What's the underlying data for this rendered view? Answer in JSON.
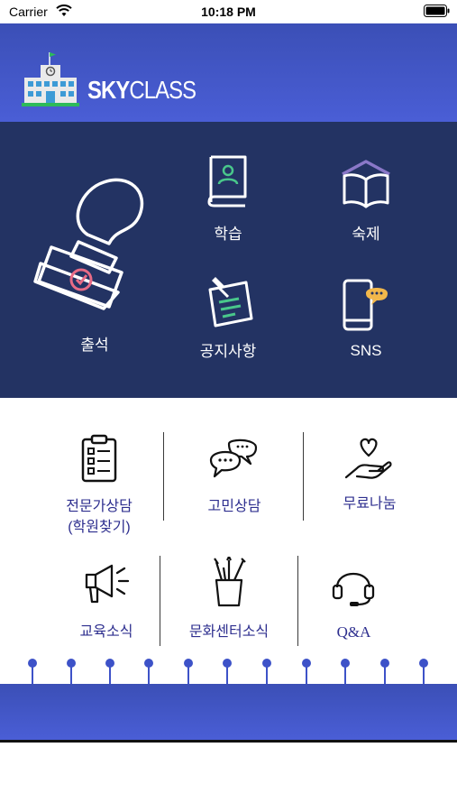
{
  "status_bar": {
    "carrier": "Carrier",
    "time": "10:18 PM"
  },
  "header": {
    "logo_bold": "SKY",
    "logo_light": "CLASS"
  },
  "dark_menu": {
    "attendance": "출석",
    "study": "학습",
    "homework": "숙제",
    "notice": "공지사항",
    "sns": "SNS"
  },
  "light_menu": {
    "consult_line1": "전문가상담",
    "consult_line2": "(학원찾기)",
    "worry": "고민상담",
    "share": "무료나눔",
    "education": "교육소식",
    "culture": "문화센터소식",
    "qa": "Q&A"
  },
  "colors": {
    "header": "#4a5ed6",
    "dark_panel": "#233363",
    "light_label": "#2e2f8f",
    "accent_green": "#49c78b",
    "accent_pink": "#e86b86",
    "sns_bubble": "#f2b84b"
  }
}
